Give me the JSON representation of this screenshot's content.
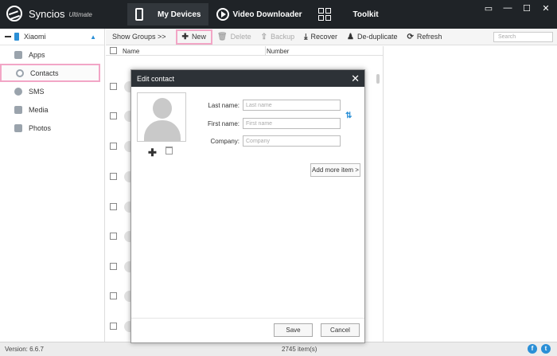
{
  "app": {
    "name": "Syncios",
    "edition": "Ultimate"
  },
  "nav": {
    "tabs": [
      "My Devices",
      "Video Downloader",
      "Toolkit"
    ]
  },
  "window_controls": [
    "▭",
    "—",
    "☐",
    "✕"
  ],
  "sidebar": {
    "device": "Xiaomi",
    "items": [
      "Apps",
      "Contacts",
      "SMS",
      "Media",
      "Photos"
    ]
  },
  "toolbar": {
    "show_groups": "Show Groups  >>",
    "new": "New",
    "delete": "Delete",
    "backup": "Backup",
    "recover": "Recover",
    "deduplicate": "De-duplicate",
    "refresh": "Refresh",
    "search_placeholder": "Search"
  },
  "list": {
    "col_name": "Name",
    "col_number": "Number"
  },
  "status": {
    "version": "Version: 6.6.7",
    "count": "2745 item(s)"
  },
  "dialog": {
    "title": "Edit contact",
    "last_name_label": "Last name:",
    "last_name_placeholder": "Last name",
    "first_name_label": "First name:",
    "first_name_placeholder": "First name",
    "company_label": "Company:",
    "company_placeholder": "Company",
    "add_more": "Add more item >",
    "save": "Save",
    "cancel": "Cancel"
  },
  "colors": {
    "accent": "#2a8fd6",
    "highlight": "#f2a6c6",
    "titlebar": "#1f2327"
  }
}
